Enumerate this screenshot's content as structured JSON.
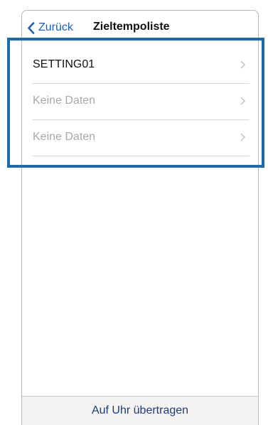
{
  "nav": {
    "back_label": "Zurück",
    "title": "Zieltempoliste"
  },
  "list": {
    "items": [
      {
        "label": "SETTING01",
        "state": "set"
      },
      {
        "label": "Keine Daten",
        "state": "empty"
      },
      {
        "label": "Keine Daten",
        "state": "empty"
      }
    ]
  },
  "footer": {
    "transfer_label": "Auf Uhr übertragen"
  },
  "colors": {
    "accent": "#1d5fb3",
    "highlight_frame": "#1b6bab",
    "placeholder_text": "#a8a8a8",
    "footer_background": "#f4f3f1"
  },
  "icons": {
    "back": "chevron-left-icon",
    "row": "chevron-right-icon"
  }
}
